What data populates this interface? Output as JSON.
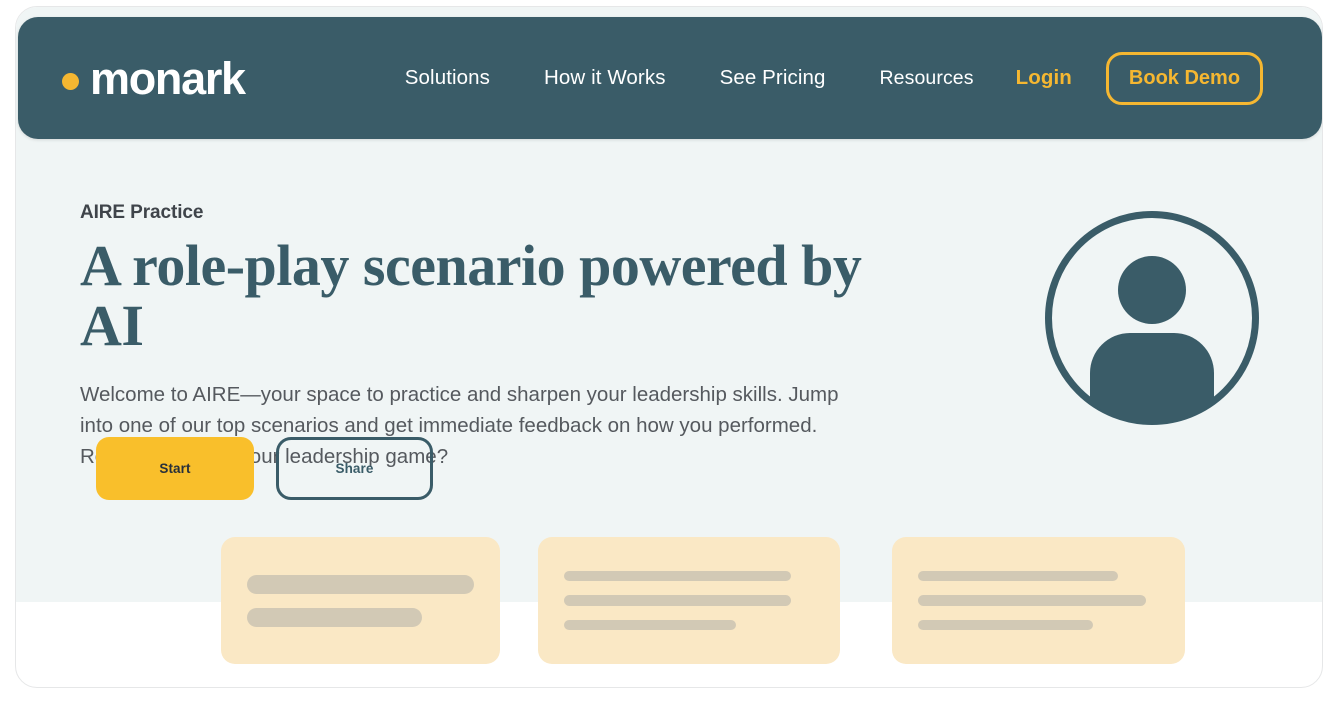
{
  "brand": {
    "name": "monark",
    "dot_color": "#f5b731"
  },
  "nav": {
    "links": [
      {
        "label": "Solutions"
      },
      {
        "label": "How it Works"
      },
      {
        "label": "See Pricing"
      },
      {
        "label": "Resources"
      }
    ],
    "login_label": "Login",
    "cta_label": "Book Demo",
    "bar_color": "#3a5c68",
    "accent_color": "#f5b731"
  },
  "hero": {
    "eyebrow": "AIRE Practice",
    "title": "A role-play scenario powered by AI",
    "body": "Welcome to AIRE—your space to practice and sharpen your leadership skills. Jump into one of our top scenarios and get immediate feedback on how you performed. Ready to elevate your leadership game?",
    "background_color": "#f0f5f5",
    "title_color": "#3a5c68"
  },
  "actions": {
    "primary_label": "Start",
    "primary_color": "#f9bf2b",
    "secondary_label": "Share",
    "secondary_border_color": "#3a5c68"
  },
  "avatar": {
    "icon": "user-avatar-icon",
    "color": "#3a5c68"
  },
  "cards": {
    "background_color": "#fae8c5",
    "line_color": "#d2c9b5",
    "items": [
      {
        "name": "placeholder-card-1",
        "lines": [
          227,
          175
        ]
      },
      {
        "name": "placeholder-card-2",
        "lines": [
          227,
          227,
          172
        ]
      },
      {
        "name": "placeholder-card-3",
        "lines": [
          200,
          228,
          175
        ]
      }
    ]
  }
}
